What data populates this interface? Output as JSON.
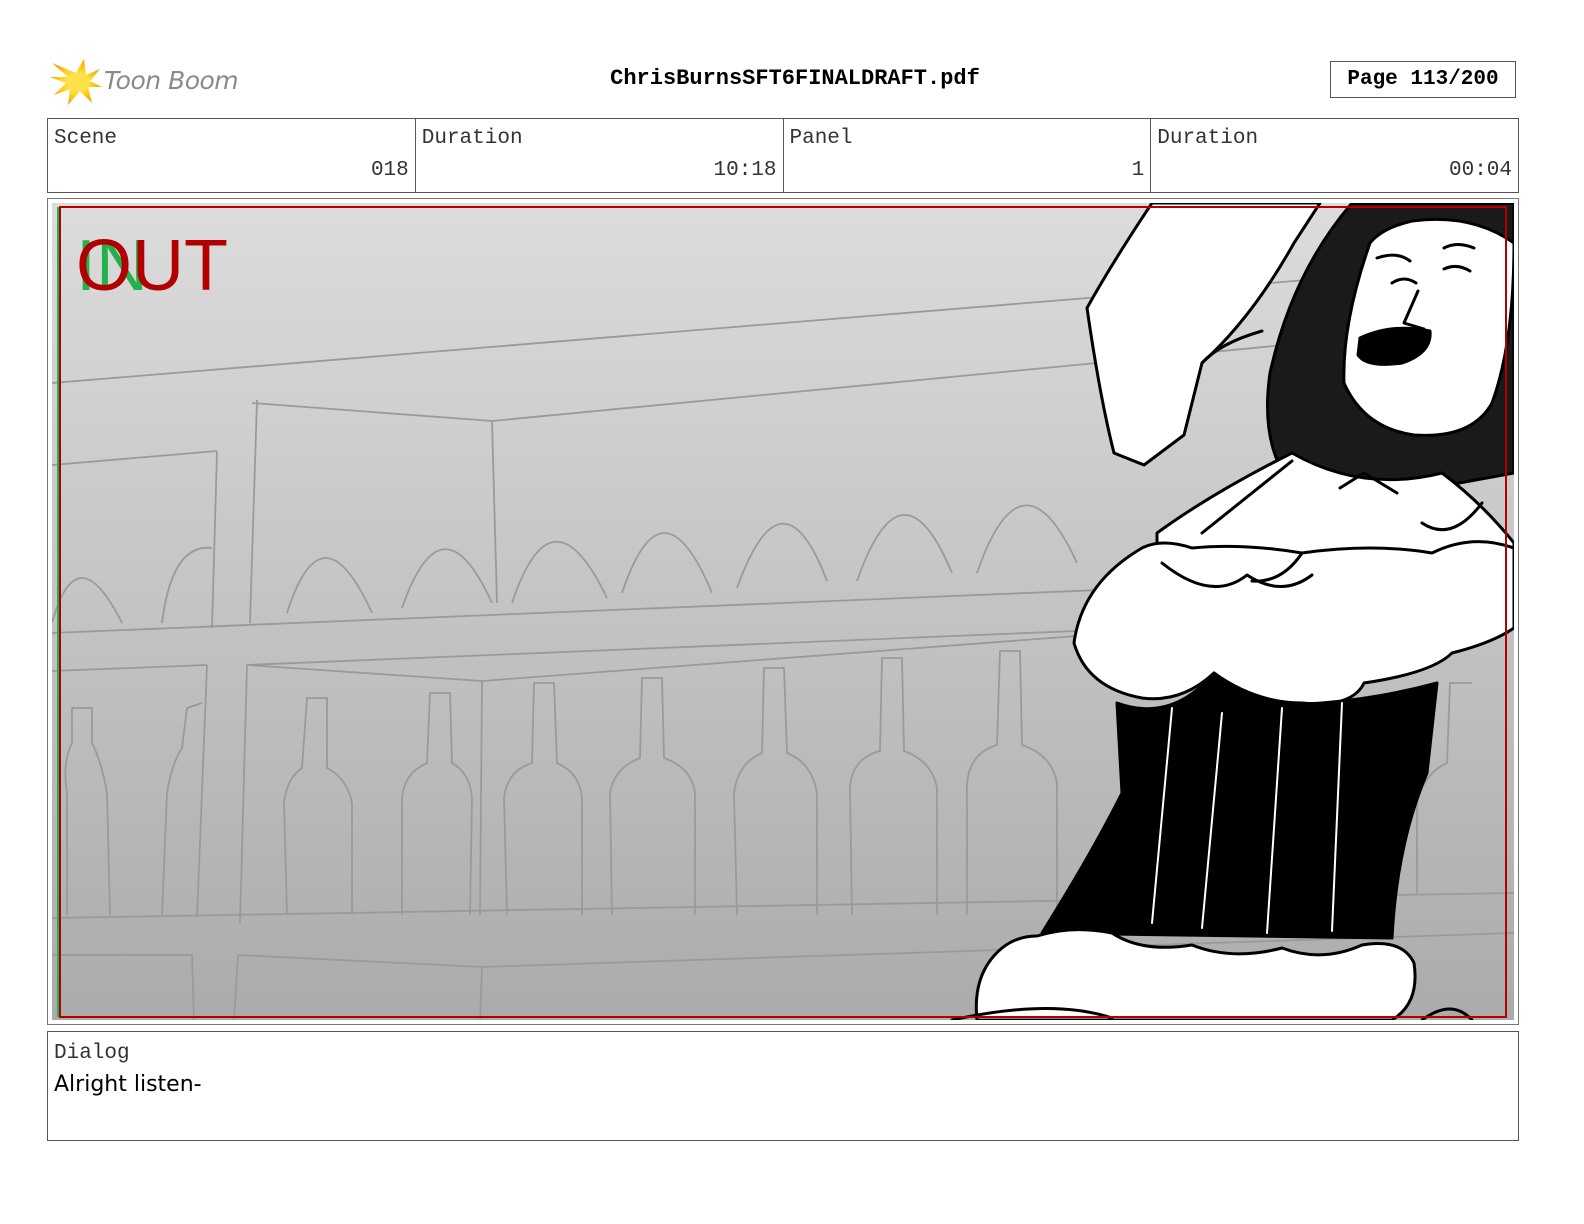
{
  "header": {
    "logo_text": "Toon Boom",
    "document_title": "ChrisBurnsSFT6FINALDRAFT.pdf",
    "page_indicator": "Page 113/200"
  },
  "info": {
    "scene_label": "Scene",
    "scene_value": "018",
    "duration_label": "Duration",
    "duration_value": "10:18",
    "panel_label": "Panel",
    "panel_value": "1",
    "panel_duration_label": "Duration",
    "panel_duration_value": "00:04"
  },
  "panel": {
    "in_marker": "IN",
    "out_marker": "OUT",
    "in_color": "#22b14c",
    "out_color": "#b20000",
    "safe_frame_color": "#b20000"
  },
  "dialog": {
    "label": "Dialog",
    "text": "Alright listen-"
  }
}
